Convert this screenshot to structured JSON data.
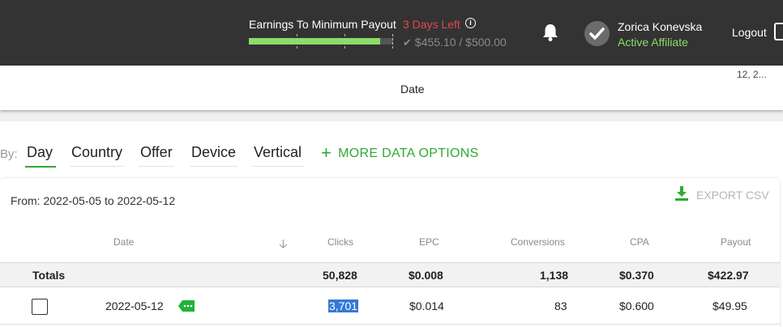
{
  "header": {
    "earnings_label": "Earnings To Minimum Payout",
    "days_left": "3 Days Left",
    "progress_fraction": 0.9102,
    "progress_amount": "$455.10 / $500.00",
    "user_name": "Zorica Konevska",
    "user_status": "Active Affiliate",
    "logout_label": "Logout"
  },
  "chart_strip": {
    "axis_label": "Date",
    "right_tick": "12, 2..."
  },
  "group_by": {
    "label": "By:",
    "tabs": [
      "Day",
      "Country",
      "Offer",
      "Device",
      "Vertical"
    ],
    "active_tab": "Day",
    "more_options": "MORE DATA OPTIONS"
  },
  "report": {
    "date_range": "From: 2022-05-05 to 2022-05-12",
    "export_label": "EXPORT CSV",
    "columns": [
      "Date",
      "Clicks",
      "EPC",
      "Conversions",
      "CPA",
      "Payout"
    ],
    "totals": {
      "label": "Totals",
      "clicks": "50,828",
      "epc": "$0.008",
      "conversions": "1,138",
      "cpa": "$0.370",
      "payout": "$422.97"
    },
    "rows": [
      {
        "date": "2022-05-12",
        "clicks": "3,701",
        "epc": "$0.014",
        "conversions": "83",
        "cpa": "$0.600",
        "payout": "$49.95"
      }
    ]
  },
  "colors": {
    "accent_green": "#2eaa35",
    "days_left_red": "#e04a4a",
    "topbar_bg": "#333333",
    "progress_green": "#8bdc6a"
  }
}
